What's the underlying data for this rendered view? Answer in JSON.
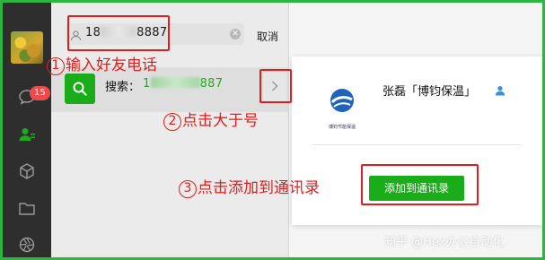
{
  "sidebar": {
    "unread_badge": "15",
    "icons": [
      "chat-icon",
      "contacts-icon",
      "cube-icon",
      "folder-icon",
      "aperture-icon"
    ]
  },
  "search": {
    "value_prefix": "18",
    "value_suffix": "8887",
    "clear_symbol": "✕",
    "cancel_label": "取消"
  },
  "result": {
    "label": "搜索：",
    "value_prefix": "1",
    "value_suffix": "887"
  },
  "contact_card": {
    "name": "张磊「博钧保温」",
    "logo_caption": "博钧节能保温",
    "add_button_label": "添加到通讯录"
  },
  "annotations": {
    "step1": {
      "num": "1",
      "text": "输入好友电话"
    },
    "step2": {
      "num": "2",
      "text": "点击大于号"
    },
    "step3": {
      "num": "3",
      "text": "点击添加到通讯录"
    }
  },
  "watermark": "知乎 @Hex办公自动化",
  "colors": {
    "frame": "#2fb341",
    "accent_green": "#1aad19",
    "annotation_red": "#e11d1d",
    "navbar": "#2e2e2e",
    "badge": "#f04b4b"
  }
}
